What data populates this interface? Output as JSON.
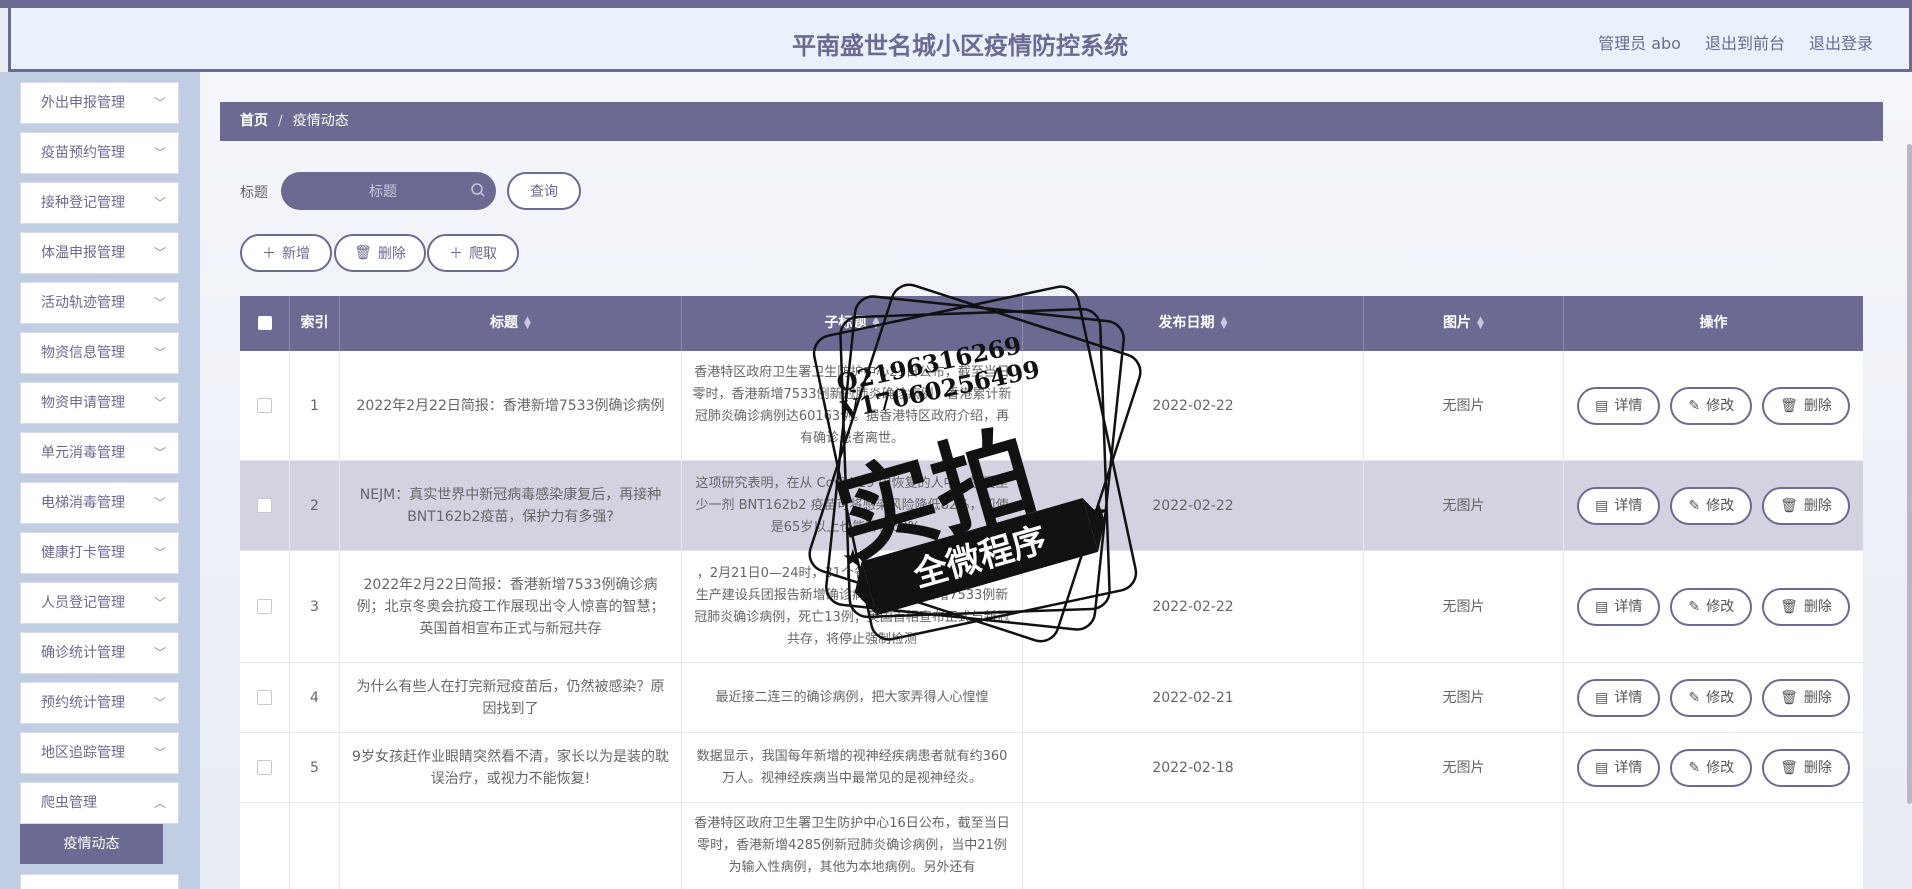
{
  "header": {
    "title": "平南盛世名城小区疫情防控系统",
    "user": "管理员 abo",
    "to_front": "退出到前台",
    "logout": "退出登录"
  },
  "sidebar": {
    "items": [
      "外出申报管理",
      "疫苗预约管理",
      "接种登记管理",
      "体温申报管理",
      "活动轨迹管理",
      "物资信息管理",
      "物资申请管理",
      "单元消毒管理",
      "电梯消毒管理",
      "健康打卡管理",
      "人员登记管理",
      "确诊统计管理",
      "预约统计管理",
      "地区追踪管理",
      "爬虫管理"
    ],
    "active_sub": "疫情动态"
  },
  "breadcrumb": {
    "home": "首页",
    "current": "疫情动态"
  },
  "search": {
    "label": "标题",
    "placeholder": "标题",
    "button": "查询"
  },
  "actions": {
    "add": "新增",
    "delete": "删除",
    "crawl": "爬取"
  },
  "table": {
    "headers": {
      "index": "索引",
      "title": "标题",
      "subtitle": "子标题",
      "date": "发布日期",
      "image": "图片",
      "ops": "操作"
    },
    "op_labels": {
      "detail": "详情",
      "edit": "修改",
      "delete": "删除"
    },
    "rows": [
      {
        "index": "1",
        "title": "2022年2月22日简报：香港新增7533例确诊病例",
        "subtitle": "香港特区政府卫生署卫生防护中心21日公布，截至当日零时，香港新增7533例新冠肺炎确诊病例，香港累计新冠肺炎确诊病例达60163例。据香港特区政府介绍，再有确诊患者离世。",
        "date": "2022-02-22",
        "image": "无图片"
      },
      {
        "index": "2",
        "title": "NEJM：真实世界中新冠病毒感染康复后，再接种BNT162b2疫苗，保护力有多强?",
        "subtitle": "这项研究表明，在从 Covid-19 中恢复的人中，接受至少一剂 BNT162b2 疫苗可将感染风险降低82%，即使是65岁以上也能降低60%。",
        "date": "2022-02-22",
        "image": "无图片"
      },
      {
        "index": "3",
        "title": "2022年2月22日简报：香港新增7533例确诊病例；北京冬奥会抗疫工作展现出令人惊喜的智慧；英国首相宣布正式与新冠共存",
        "subtitle": "，2月21日0—24时，31个省(自治区、直辖市)和新疆生产建设兵团报告新增确诊病例，，香港新增7533例新冠肺炎确诊病例，死亡13例；英国首相宣布正式与新冠共存，将停止强制检测",
        "date": "2022-02-22",
        "image": "无图片"
      },
      {
        "index": "4",
        "title": "为什么有些人在打完新冠疫苗后，仍然被感染？原因找到了",
        "subtitle": "最近接二连三的确诊病例，把大家弄得人心惶惶",
        "date": "2022-02-21",
        "image": "无图片"
      },
      {
        "index": "5",
        "title": "9岁女孩赶作业眼睛突然看不清，家长以为是装的耽误治疗，或视力不能恢复!",
        "subtitle": "数据显示，我国每年新增的视神经疾病患者就有约360万人。视神经疾病当中最常见的是视神经炎。",
        "date": "2022-02-18",
        "image": "无图片"
      },
      {
        "index": "",
        "title": "",
        "subtitle": "香港特区政府卫生署卫生防护中心16日公布，截至当日零时，香港新增4285例新冠肺炎确诊病例，当中21例为输入性病例，其他为本地病例。另外还有",
        "date": "",
        "image": ""
      }
    ]
  },
  "watermark": {
    "line1": "Q2196316269",
    "line2": "V17060256499",
    "big": "实拍",
    "ribbon": "全微程序"
  },
  "colors": {
    "accent": "#6b6a92",
    "sidebar_bg": "#c1cde3",
    "header_bg": "#eaf1fb"
  }
}
